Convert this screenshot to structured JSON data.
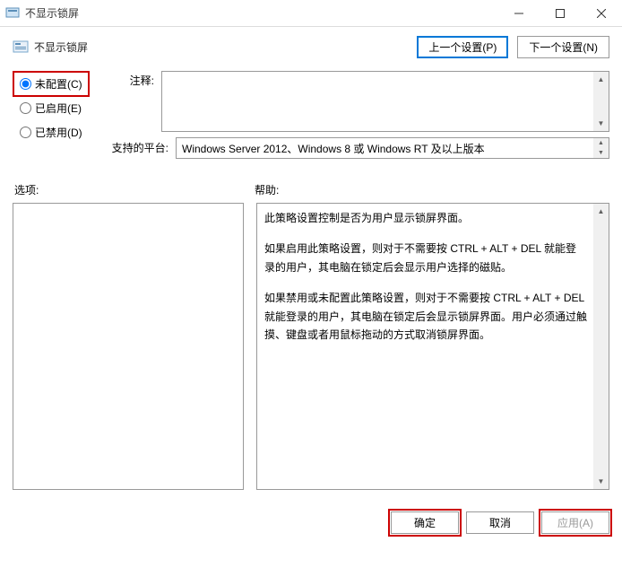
{
  "titlebar": {
    "title": "不显示锁屏"
  },
  "header": {
    "title": "不显示锁屏",
    "prev_button": "上一个设置(P)",
    "next_button": "下一个设置(N)"
  },
  "radios": {
    "not_configured": "未配置(C)",
    "enabled": "已启用(E)",
    "disabled": "已禁用(D)"
  },
  "labels": {
    "annotation": "注释:",
    "supported_platform": "支持的平台:",
    "options": "选项:",
    "help": "帮助:"
  },
  "platform_text": "Windows Server 2012、Windows 8 或 Windows RT 及以上版本",
  "help_text": {
    "p1": "此策略设置控制是否为用户显示锁屏界面。",
    "p2": "如果启用此策略设置，则对于不需要按 CTRL + ALT + DEL  就能登录的用户，其电脑在锁定后会显示用户选择的磁贴。",
    "p3": "如果禁用或未配置此策略设置，则对于不需要按 CTRL + ALT + DEL 就能登录的用户，其电脑在锁定后会显示锁屏界面。用户必须通过触摸、键盘或者用鼠标拖动的方式取消锁屏界面。"
  },
  "footer": {
    "ok": "确定",
    "cancel": "取消",
    "apply": "应用(A)"
  }
}
